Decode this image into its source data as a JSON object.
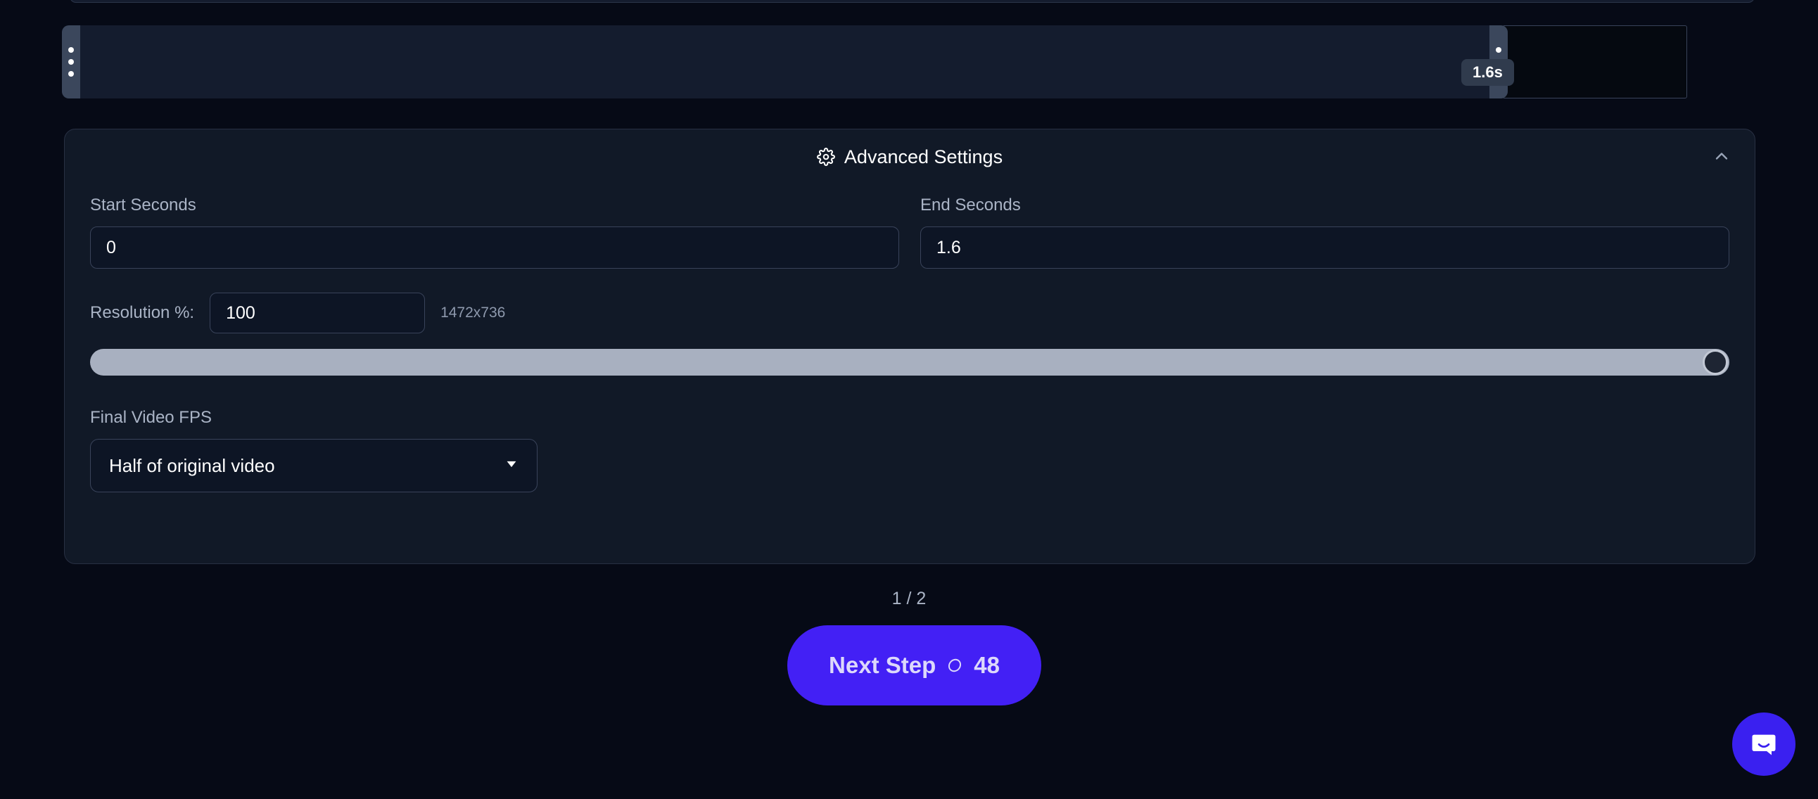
{
  "timeline": {
    "duration_badge": "1.6s",
    "left_handle_name": "trim-start-handle",
    "right_handle_name": "trim-end-handle"
  },
  "panel": {
    "title": "Advanced Settings",
    "gear_icon": "gear-icon",
    "collapse_icon": "chevron-up-icon"
  },
  "fields": {
    "start_seconds": {
      "label": "Start Seconds",
      "value": "0",
      "placeholder": "0"
    },
    "end_seconds": {
      "label": "End Seconds",
      "value": "1.6",
      "placeholder": "0"
    },
    "resolution": {
      "label": "Resolution %:",
      "value": "100",
      "placeholder": "100",
      "dimensions": "1472x736",
      "slider_percent": 100
    },
    "fps": {
      "label": "Final Video FPS",
      "selected": "Half of original video",
      "caret_icon": "chevron-down-icon"
    }
  },
  "footer": {
    "pager": "1 / 2",
    "next_step_label": "Next Step",
    "credits": "48",
    "coin_icon": "credit-coin-icon"
  },
  "support": {
    "chat_icon": "intercom-chat-icon"
  },
  "colors": {
    "page_bg": "#060a16",
    "panel_bg": "#111927",
    "accent": "#4320f5",
    "slider_track": "#a8b0c0",
    "handle": "#3b475c",
    "badge_bg": "#303b4d"
  }
}
